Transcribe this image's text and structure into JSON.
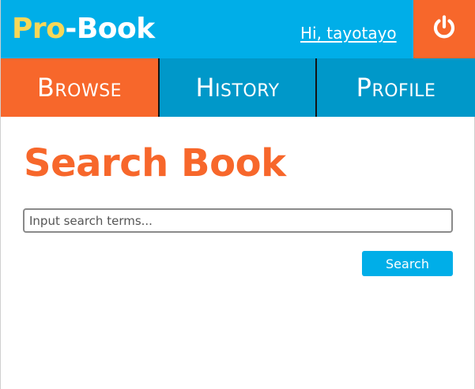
{
  "header": {
    "logo_part1": "Pro",
    "logo_part2": "-Book",
    "greeting": "Hi, tayotayo",
    "logout_icon": "power-icon"
  },
  "nav": {
    "tabs": [
      {
        "label": "Browse",
        "active": true
      },
      {
        "label": "History",
        "active": false
      },
      {
        "label": "Profile",
        "active": false
      }
    ]
  },
  "main": {
    "title": "Search Book",
    "search": {
      "placeholder": "Input search terms...",
      "value": ""
    },
    "search_button_label": "Search"
  },
  "colors": {
    "primary_blue": "#00aee8",
    "nav_blue": "#0098c9",
    "accent_orange": "#f7672b",
    "logo_yellow": "#f7d758"
  }
}
